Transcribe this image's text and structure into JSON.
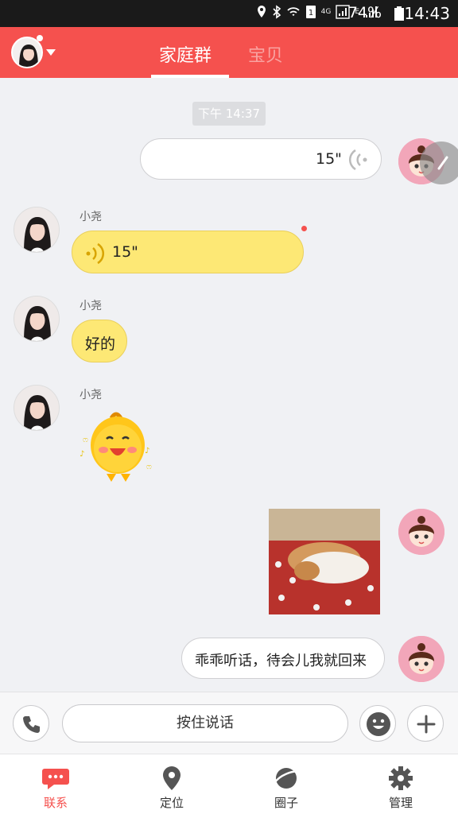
{
  "status_bar": {
    "network": "4G",
    "carrier_e": "E",
    "battery": "74%",
    "time": "14:43"
  },
  "header": {
    "tabs": [
      {
        "label": "家庭群",
        "active": true
      },
      {
        "label": "宝贝",
        "active": false
      }
    ],
    "accent_color": "#f5514e"
  },
  "chat": {
    "timestamp": "下午 14:37",
    "messages": [
      {
        "side": "right",
        "type": "voice",
        "duration": "15\"",
        "avatar": "doll-avatar"
      },
      {
        "side": "left",
        "type": "voice",
        "sender": "小尧",
        "duration": "15\"",
        "unread": true,
        "avatar": "girl-avatar"
      },
      {
        "side": "left",
        "type": "text",
        "sender": "小尧",
        "text": "好的",
        "avatar": "girl-avatar"
      },
      {
        "side": "left",
        "type": "sticker",
        "sender": "小尧",
        "sticker": "yellow-chick-sticker",
        "avatar": "girl-avatar"
      },
      {
        "side": "right",
        "type": "image",
        "image": "sleeping-dogs-photo",
        "avatar": "doll-avatar"
      },
      {
        "side": "right",
        "type": "text",
        "text": "乖乖听话，待会儿我就回来",
        "avatar": "doll-avatar"
      }
    ]
  },
  "input_bar": {
    "talk_label": "按住说话",
    "icons": [
      "phone-icon",
      "emoji-icon",
      "plus-icon"
    ]
  },
  "bottom_nav": {
    "items": [
      {
        "label": "联系",
        "icon": "chat-icon",
        "active": true
      },
      {
        "label": "定位",
        "icon": "location-pin-icon",
        "active": false
      },
      {
        "label": "圈子",
        "icon": "planet-icon",
        "active": false
      },
      {
        "label": "管理",
        "icon": "gear-icon",
        "active": false
      }
    ]
  }
}
